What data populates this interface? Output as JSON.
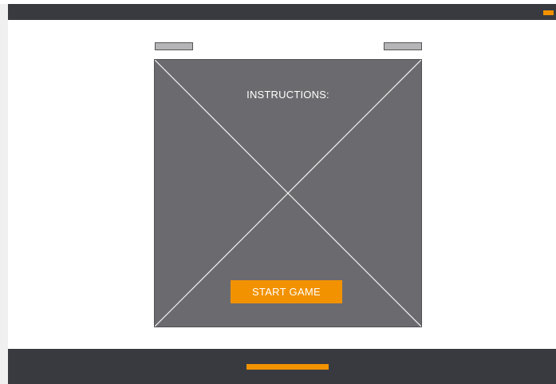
{
  "colors": {
    "bar": "#393a40",
    "accent": "#f29200",
    "placeholder": "#6b6b6f",
    "tab": "#b5b5b7"
  },
  "top_bar": {
    "accent_icon": "orange-menu-marker"
  },
  "toolbar": {
    "left_button_label": "",
    "right_button_label": ""
  },
  "game_area": {
    "instructions": "INSTRUCTIONS:",
    "image_placeholder_icon": "x-placeholder-icon",
    "start_button_label": "START GAME"
  },
  "bottom_bar": {
    "indicator_icon": "orange-progress-indicator"
  }
}
